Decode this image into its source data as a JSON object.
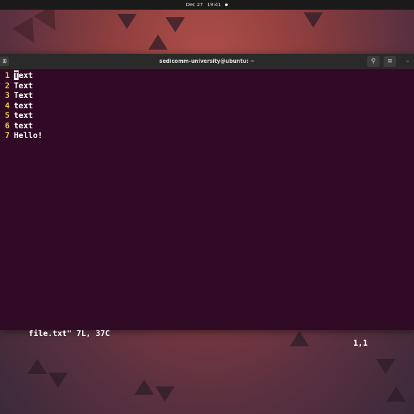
{
  "topbar": {
    "date": "Dec 27",
    "time": "19:41"
  },
  "window": {
    "title": "sedicomm-university@ubuntu: ~",
    "new_tab_icon": "new-tab-icon",
    "search_icon": "search-icon",
    "menu_icon": "hamburger-menu-icon",
    "minimize_icon": "minimize-icon"
  },
  "editor": {
    "lines": [
      {
        "num": "1",
        "cursor_char": "T",
        "rest": "ext"
      },
      {
        "num": "2",
        "text": "Text"
      },
      {
        "num": "3",
        "text": "Text"
      },
      {
        "num": "4",
        "text": "text"
      },
      {
        "num": "5",
        "text": "text"
      },
      {
        "num": "6",
        "text": "text"
      },
      {
        "num": "7",
        "text": "Hello!"
      }
    ],
    "status_file": "file.txt\" 7L, 37C",
    "status_pos": "1,1"
  },
  "colors": {
    "terminal_bg": "#300a24",
    "line_number": "#e8c54a",
    "text": "#ffffff"
  }
}
